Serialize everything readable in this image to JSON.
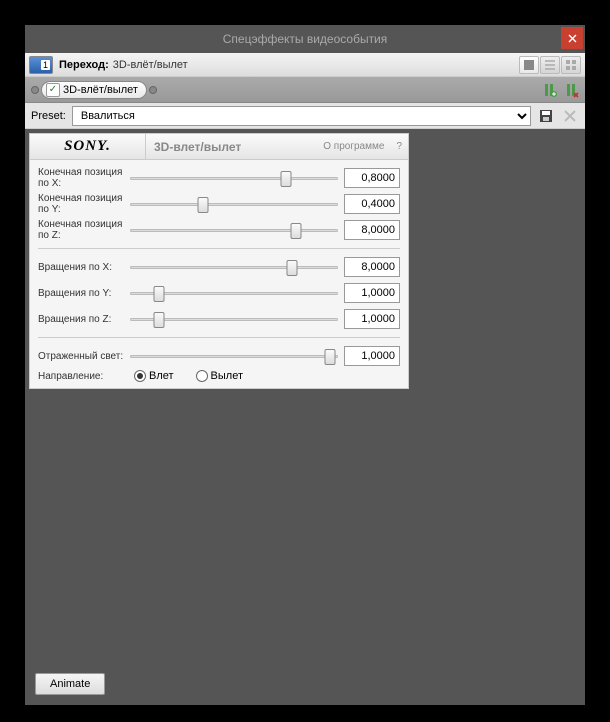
{
  "window": {
    "title": "Спецэффекты видеособытия"
  },
  "transition": {
    "badge_number": "1",
    "label": "Переход:",
    "name": "3D-влёт/вылет"
  },
  "chain": {
    "effect_name": "3D-влёт/вылет"
  },
  "preset": {
    "label": "Preset:",
    "value": "Ввалиться"
  },
  "plugin": {
    "brand": "SONY.",
    "name": "3D-влет/вылет",
    "about": "О программе",
    "help": "?"
  },
  "params": {
    "pos_x": {
      "label": "Конечная позиция по X:",
      "value": "0,8000",
      "pos": 75
    },
    "pos_y": {
      "label": "Конечная позиция по Y:",
      "value": "0,4000",
      "pos": 35
    },
    "pos_z": {
      "label": "Конечная позиция по Z:",
      "value": "8,0000",
      "pos": 80
    },
    "rot_x": {
      "label": "Вращения по X:",
      "value": "8,0000",
      "pos": 78
    },
    "rot_y": {
      "label": "Вращения по Y:",
      "value": "1,0000",
      "pos": 14
    },
    "rot_z": {
      "label": "Вращения по Z:",
      "value": "1,0000",
      "pos": 14
    },
    "reflect": {
      "label": "Отраженный свет:",
      "value": "1,0000",
      "pos": 96
    }
  },
  "direction": {
    "label": "Направление:",
    "opt_in": "Влет",
    "opt_out": "Вылет",
    "selected": "in"
  },
  "footer": {
    "animate": "Animate"
  }
}
